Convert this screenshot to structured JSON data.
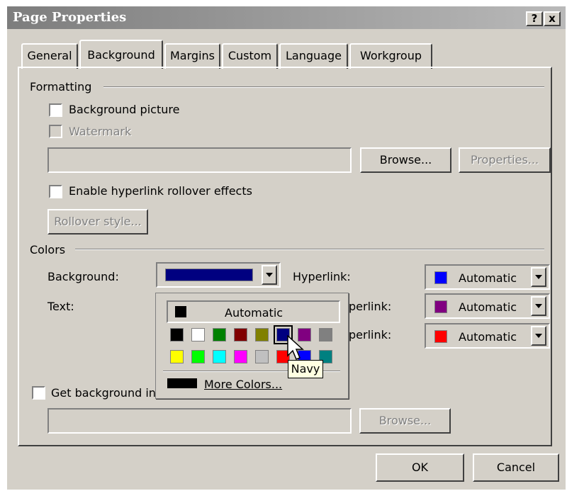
{
  "window": {
    "title": "Page Properties",
    "help_label": "?",
    "close_label": "x"
  },
  "tabs": [
    "General",
    "Background",
    "Margins",
    "Custom",
    "Language",
    "Workgroup"
  ],
  "formatting": {
    "group_label": "Formatting",
    "background_picture": "Background picture",
    "watermark": "Watermark",
    "browse": "Browse...",
    "properties": "Properties...",
    "rollover_effects": "Enable hyperlink rollover effects",
    "rollover_style": "Rollover style..."
  },
  "colors": {
    "group_label": "Colors",
    "background_label": "Background:",
    "background_value": "#000080",
    "text_label": "Text:",
    "hyperlink_label": "Hyperlink:",
    "visited_label": "perlink:",
    "active_label": "perlink:",
    "hyperlink": {
      "text": "Automatic",
      "swatch": "#0000ff"
    },
    "visited": {
      "text": "Automatic",
      "swatch": "#800080"
    },
    "active": {
      "text": "Automatic",
      "swatch": "#ff0000"
    }
  },
  "palette": {
    "automatic": "Automatic",
    "automatic_swatch": "#000000",
    "row1": [
      "#000000",
      "#ffffff",
      "#008000",
      "#800000",
      "#808000",
      "#000080",
      "#800080",
      "#808080"
    ],
    "row2": [
      "#ffff00",
      "#00ff00",
      "#00ffff",
      "#ff00ff",
      "#c0c0c0",
      "#ff0000",
      "#0000ff",
      "#008080"
    ],
    "more_colors": "More Colors...",
    "tooltip": "Navy"
  },
  "get_background": {
    "label": "Get background in",
    "browse": "Browse..."
  },
  "buttons": {
    "ok": "OK",
    "cancel": "Cancel"
  }
}
